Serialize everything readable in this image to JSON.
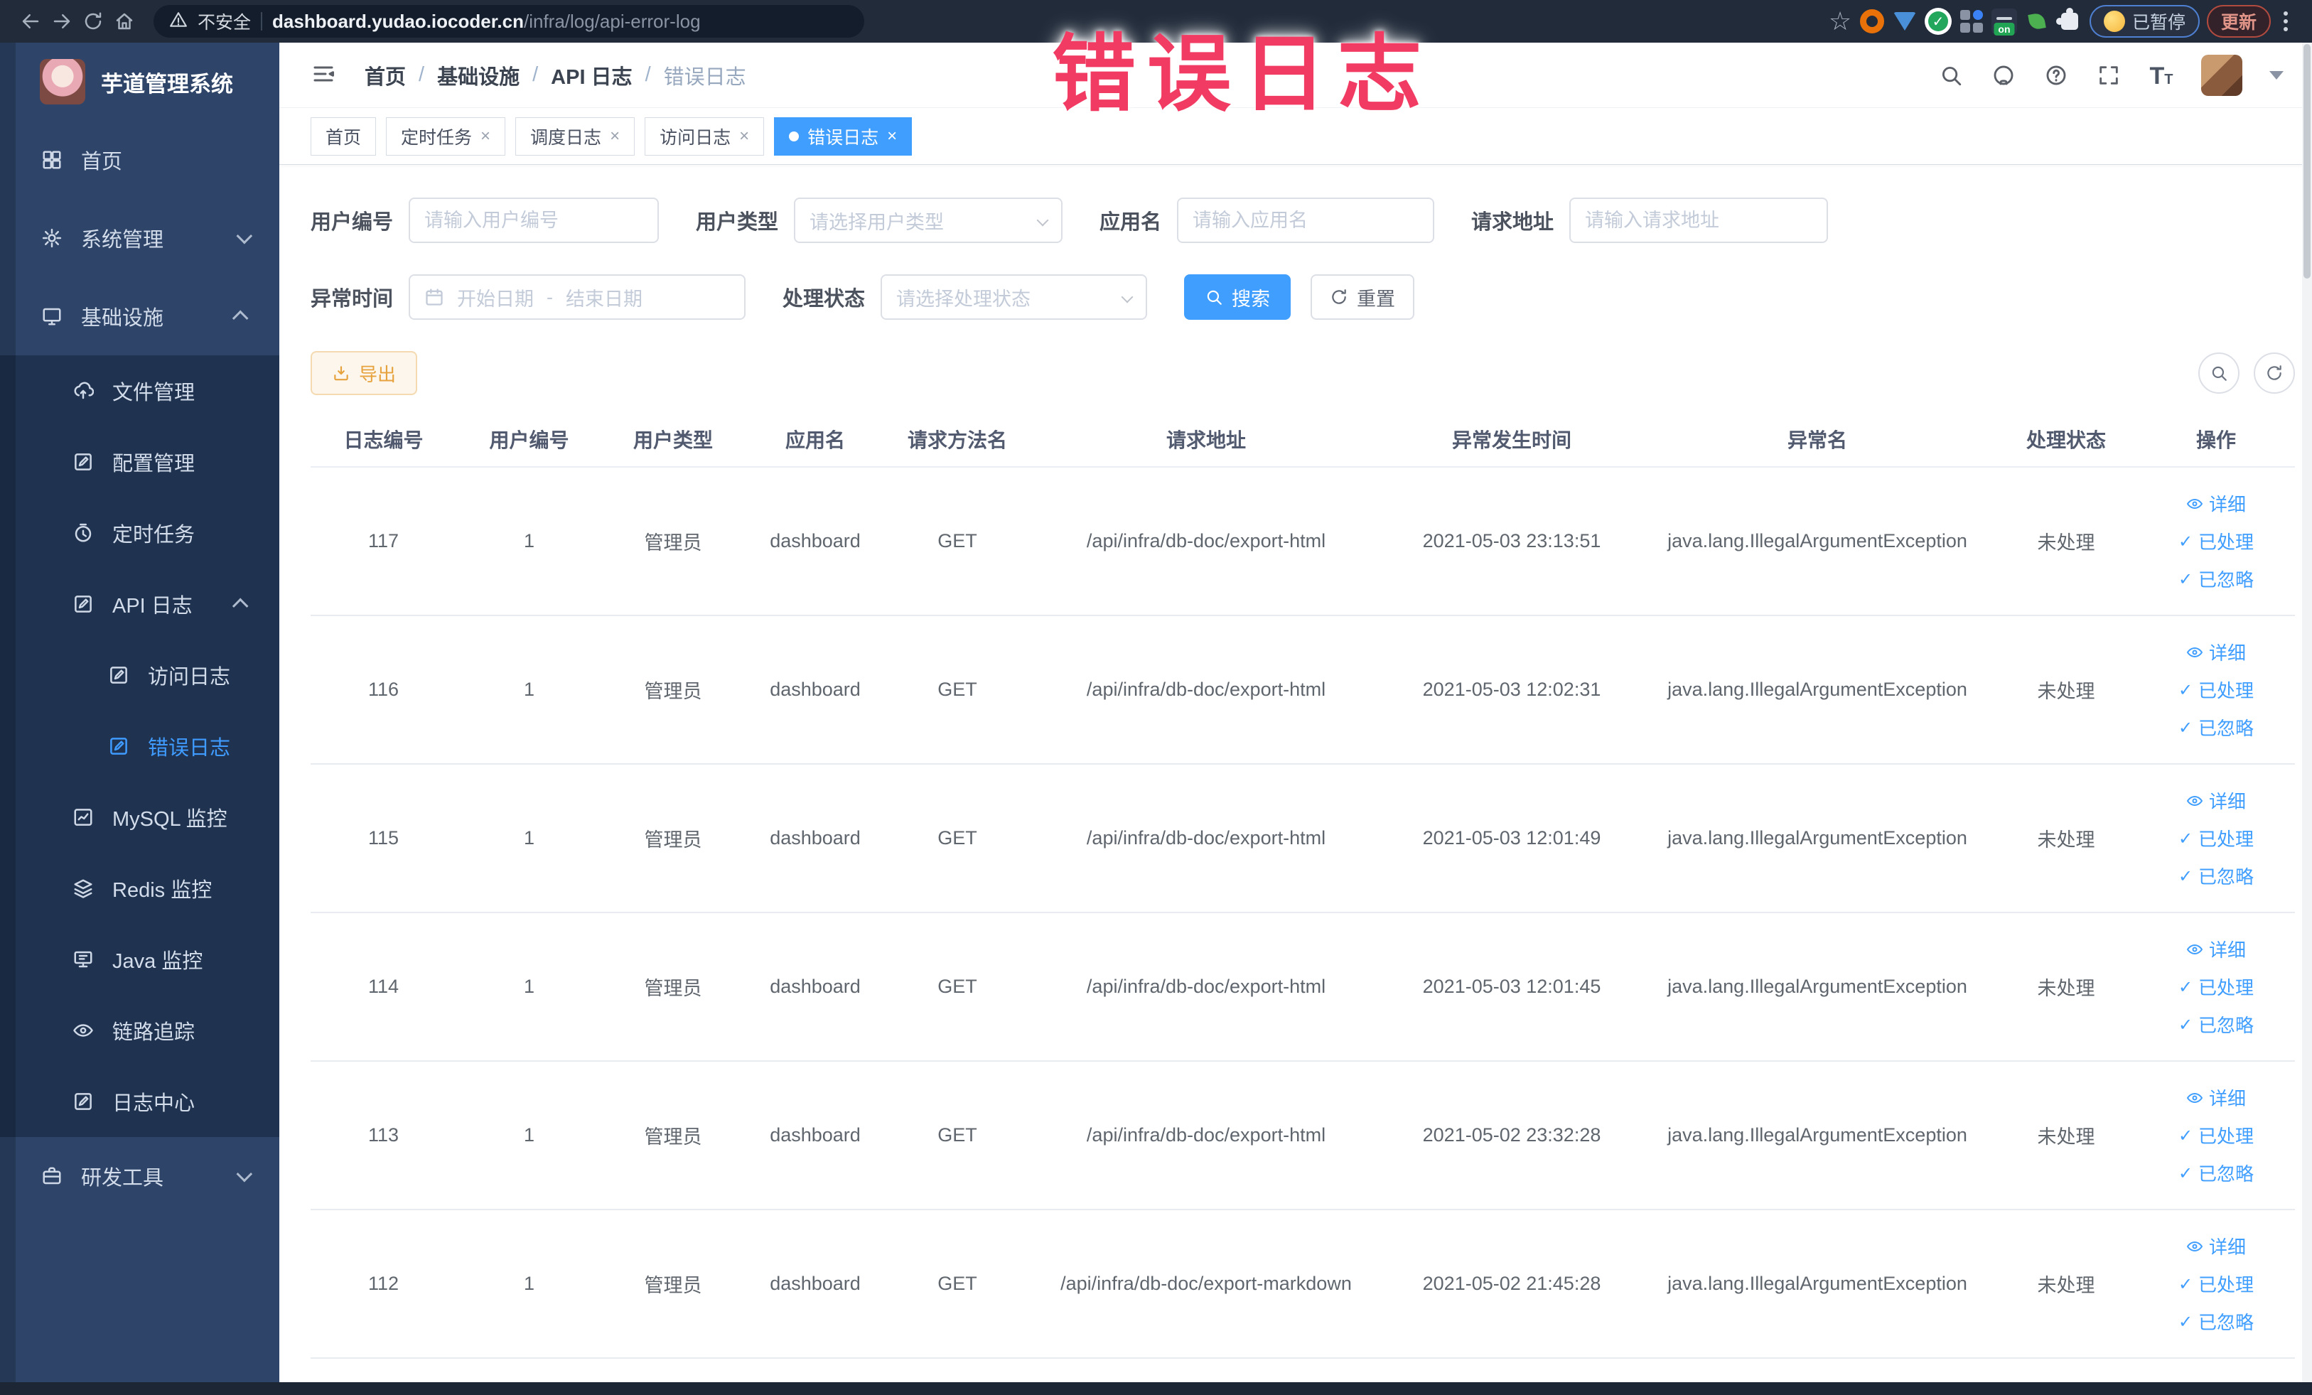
{
  "colors": {
    "accent": "#409eff",
    "annotation": "#f23b62",
    "export_warning": "#e6a23c",
    "sidebar_bg": "#2e4569",
    "submenu_bg": "#1f3350"
  },
  "browser": {
    "insecure_label": "不安全",
    "url_domain": "dashboard.yudao.iocoder.cn",
    "url_path": "/infra/log/api-error-log",
    "paused_label": "已暂停",
    "update_label": "更新",
    "ext_on_label": "on"
  },
  "annotation": {
    "text": "错误日志"
  },
  "sidebar": {
    "title": "芋道管理系统",
    "items": [
      {
        "label": "首页"
      },
      {
        "label": "系统管理"
      },
      {
        "label": "基础设施"
      },
      {
        "label": "文件管理"
      },
      {
        "label": "配置管理"
      },
      {
        "label": "定时任务"
      },
      {
        "label": "API 日志"
      },
      {
        "label": "访问日志"
      },
      {
        "label": "错误日志"
      },
      {
        "label": "MySQL 监控"
      },
      {
        "label": "Redis 监控"
      },
      {
        "label": "Java 监控"
      },
      {
        "label": "链路追踪"
      },
      {
        "label": "日志中心"
      },
      {
        "label": "研发工具"
      }
    ]
  },
  "breadcrumb": {
    "items": [
      "首页",
      "基础设施",
      "API 日志",
      "错误日志"
    ]
  },
  "tabs": [
    {
      "label": "首页"
    },
    {
      "label": "定时任务"
    },
    {
      "label": "调度日志"
    },
    {
      "label": "访问日志"
    },
    {
      "label": "错误日志"
    }
  ],
  "filters": {
    "user_id_label": "用户编号",
    "user_id_placeholder": "请输入用户编号",
    "user_type_label": "用户类型",
    "user_type_placeholder": "请选择用户类型",
    "app_name_label": "应用名",
    "app_name_placeholder": "请输入应用名",
    "request_url_label": "请求地址",
    "request_url_placeholder": "请输入请求地址",
    "exception_time_label": "异常时间",
    "date_start_placeholder": "开始日期",
    "date_separator": "-",
    "date_end_placeholder": "结束日期",
    "process_status_label": "处理状态",
    "process_status_placeholder": "请选择处理状态",
    "search_label": "搜索",
    "reset_label": "重置"
  },
  "toolbar": {
    "export_label": "导出"
  },
  "table": {
    "headers": [
      "日志编号",
      "用户编号",
      "用户类型",
      "应用名",
      "请求方法名",
      "请求地址",
      "异常发生时间",
      "异常名",
      "处理状态",
      "操作"
    ],
    "actions": {
      "detail": "详细",
      "processed": "已处理",
      "ignored": "已忽略"
    },
    "rows": [
      {
        "id": "117",
        "user_id": "1",
        "user_type": "管理员",
        "app": "dashboard",
        "method": "GET",
        "url": "/api/infra/db-doc/export-html",
        "time": "2021-05-03 23:13:51",
        "exception": "java.lang.IllegalArgumentException",
        "status": "未处理"
      },
      {
        "id": "116",
        "user_id": "1",
        "user_type": "管理员",
        "app": "dashboard",
        "method": "GET",
        "url": "/api/infra/db-doc/export-html",
        "time": "2021-05-03 12:02:31",
        "exception": "java.lang.IllegalArgumentException",
        "status": "未处理"
      },
      {
        "id": "115",
        "user_id": "1",
        "user_type": "管理员",
        "app": "dashboard",
        "method": "GET",
        "url": "/api/infra/db-doc/export-html",
        "time": "2021-05-03 12:01:49",
        "exception": "java.lang.IllegalArgumentException",
        "status": "未处理"
      },
      {
        "id": "114",
        "user_id": "1",
        "user_type": "管理员",
        "app": "dashboard",
        "method": "GET",
        "url": "/api/infra/db-doc/export-html",
        "time": "2021-05-03 12:01:45",
        "exception": "java.lang.IllegalArgumentException",
        "status": "未处理"
      },
      {
        "id": "113",
        "user_id": "1",
        "user_type": "管理员",
        "app": "dashboard",
        "method": "GET",
        "url": "/api/infra/db-doc/export-html",
        "time": "2021-05-02 23:32:28",
        "exception": "java.lang.IllegalArgumentException",
        "status": "未处理"
      },
      {
        "id": "112",
        "user_id": "1",
        "user_type": "管理员",
        "app": "dashboard",
        "method": "GET",
        "url": "/api/infra/db-doc/export-markdown",
        "time": "2021-05-02 21:45:28",
        "exception": "java.lang.IllegalArgumentException",
        "status": "未处理"
      }
    ]
  }
}
